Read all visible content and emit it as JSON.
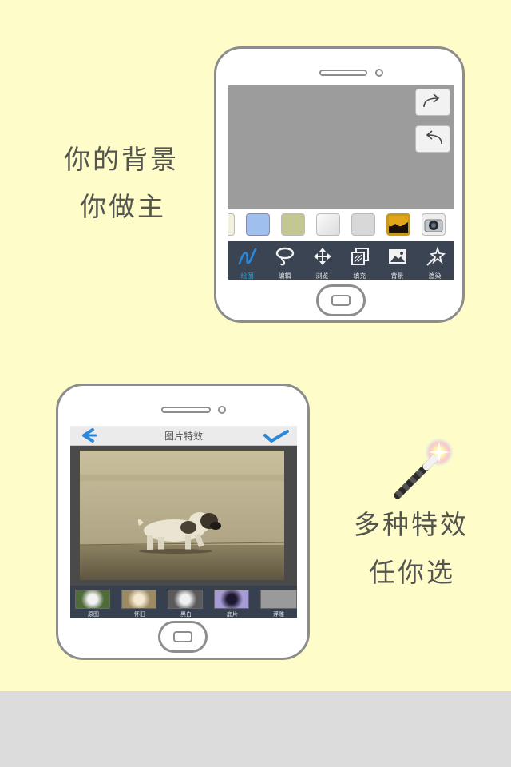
{
  "taglines": {
    "background_line1": "你的背景",
    "background_line2": "你做主",
    "effects_line1": "多种特效",
    "effects_line2": "任你选"
  },
  "editor": {
    "redo_icon": "redo-arrow-icon",
    "undo_icon": "undo-arrow-icon",
    "swatches": [
      "partial",
      "light-blue",
      "olive",
      "paper-white",
      "gray",
      "gold-frame",
      "camera"
    ],
    "tools": [
      {
        "label": "绘图",
        "icon": "draw-curve-icon",
        "active": true
      },
      {
        "label": "编辑",
        "icon": "lasso-icon",
        "active": false
      },
      {
        "label": "浏览",
        "icon": "move-arrows-icon",
        "active": false
      },
      {
        "label": "填充",
        "icon": "fill-layers-icon",
        "active": false
      },
      {
        "label": "背景",
        "icon": "image-icon",
        "active": false
      },
      {
        "label": "渲染",
        "icon": "magic-star-icon",
        "active": false
      }
    ]
  },
  "effects_screen": {
    "title": "图片特效",
    "back_icon": "back-chevron-icon",
    "confirm_icon": "checkmark-icon",
    "filters": [
      "原图",
      "怀旧",
      "黑白",
      "底片",
      "浮雕"
    ]
  },
  "colors": {
    "background": "#fefcc9",
    "toolbar": "#3a4453",
    "accent_blue": "#2b87d8"
  }
}
